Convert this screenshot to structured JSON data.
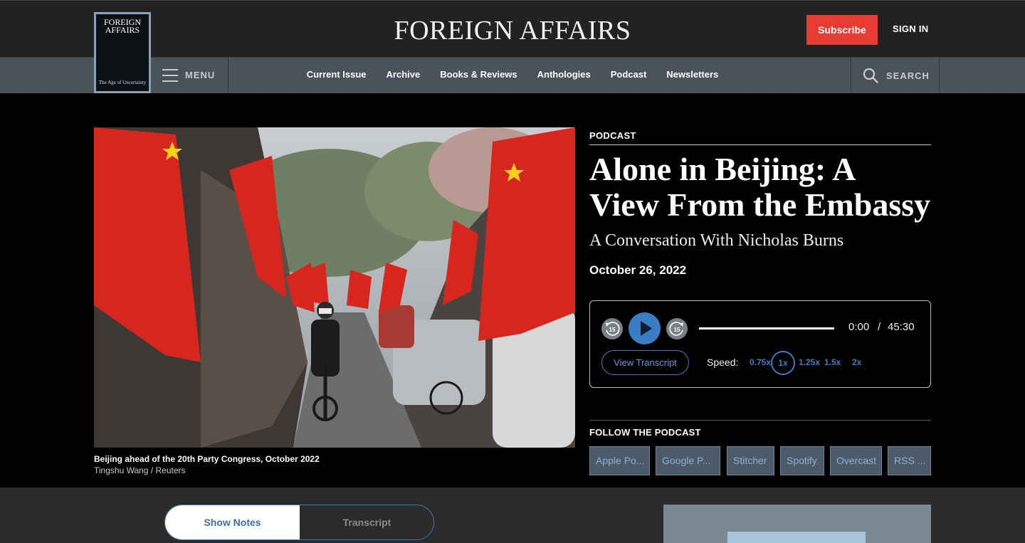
{
  "header": {
    "logo": "FOREIGN AFFAIRS",
    "subscribe_label": "Subscribe",
    "signin_label": "SIGN IN"
  },
  "cover": {
    "title_line1": "FOREIGN",
    "title_line2": "AFFAIRS",
    "subtitle": "The Age of Uncertainty"
  },
  "nav": {
    "menu_label": "MENU",
    "search_label": "SEARCH",
    "links": [
      "Current Issue",
      "Archive",
      "Books & Reviews",
      "Anthologies",
      "Podcast",
      "Newsletters"
    ]
  },
  "article": {
    "kicker": "PODCAST",
    "headline": "Alone in Beijing: A View From the Embassy",
    "dek": "A Conversation With Nicholas Burns",
    "date": "October 26, 2022",
    "photo_caption": "Beijing ahead of the 20th Party Congress, October 2022",
    "photo_credit": "Tingshu Wang / Reuters"
  },
  "player": {
    "skip_back_label": "15",
    "skip_forward_label": "15",
    "current_time": "0:00",
    "separator": "/",
    "total_time": "45:30",
    "progress": 0,
    "transcript_button": "View Transcript",
    "speed_label": "Speed:",
    "speeds": [
      "0.75x",
      "1x",
      "1.25x",
      "1.5x",
      "2x"
    ],
    "active_speed": "1x"
  },
  "follow": {
    "title": "FOLLOW THE PODCAST",
    "platforms": [
      "Apple Po...",
      "Google P...",
      "Stitcher",
      "Spotify",
      "Overcast",
      "RSS ..."
    ]
  },
  "tabs": {
    "show_notes": "Show Notes",
    "transcript": "Transcript"
  },
  "colors": {
    "accent": "#3b7dc4",
    "subscribe": "#e63c34",
    "topbar": "#222222",
    "navbar": "#4a525b"
  }
}
